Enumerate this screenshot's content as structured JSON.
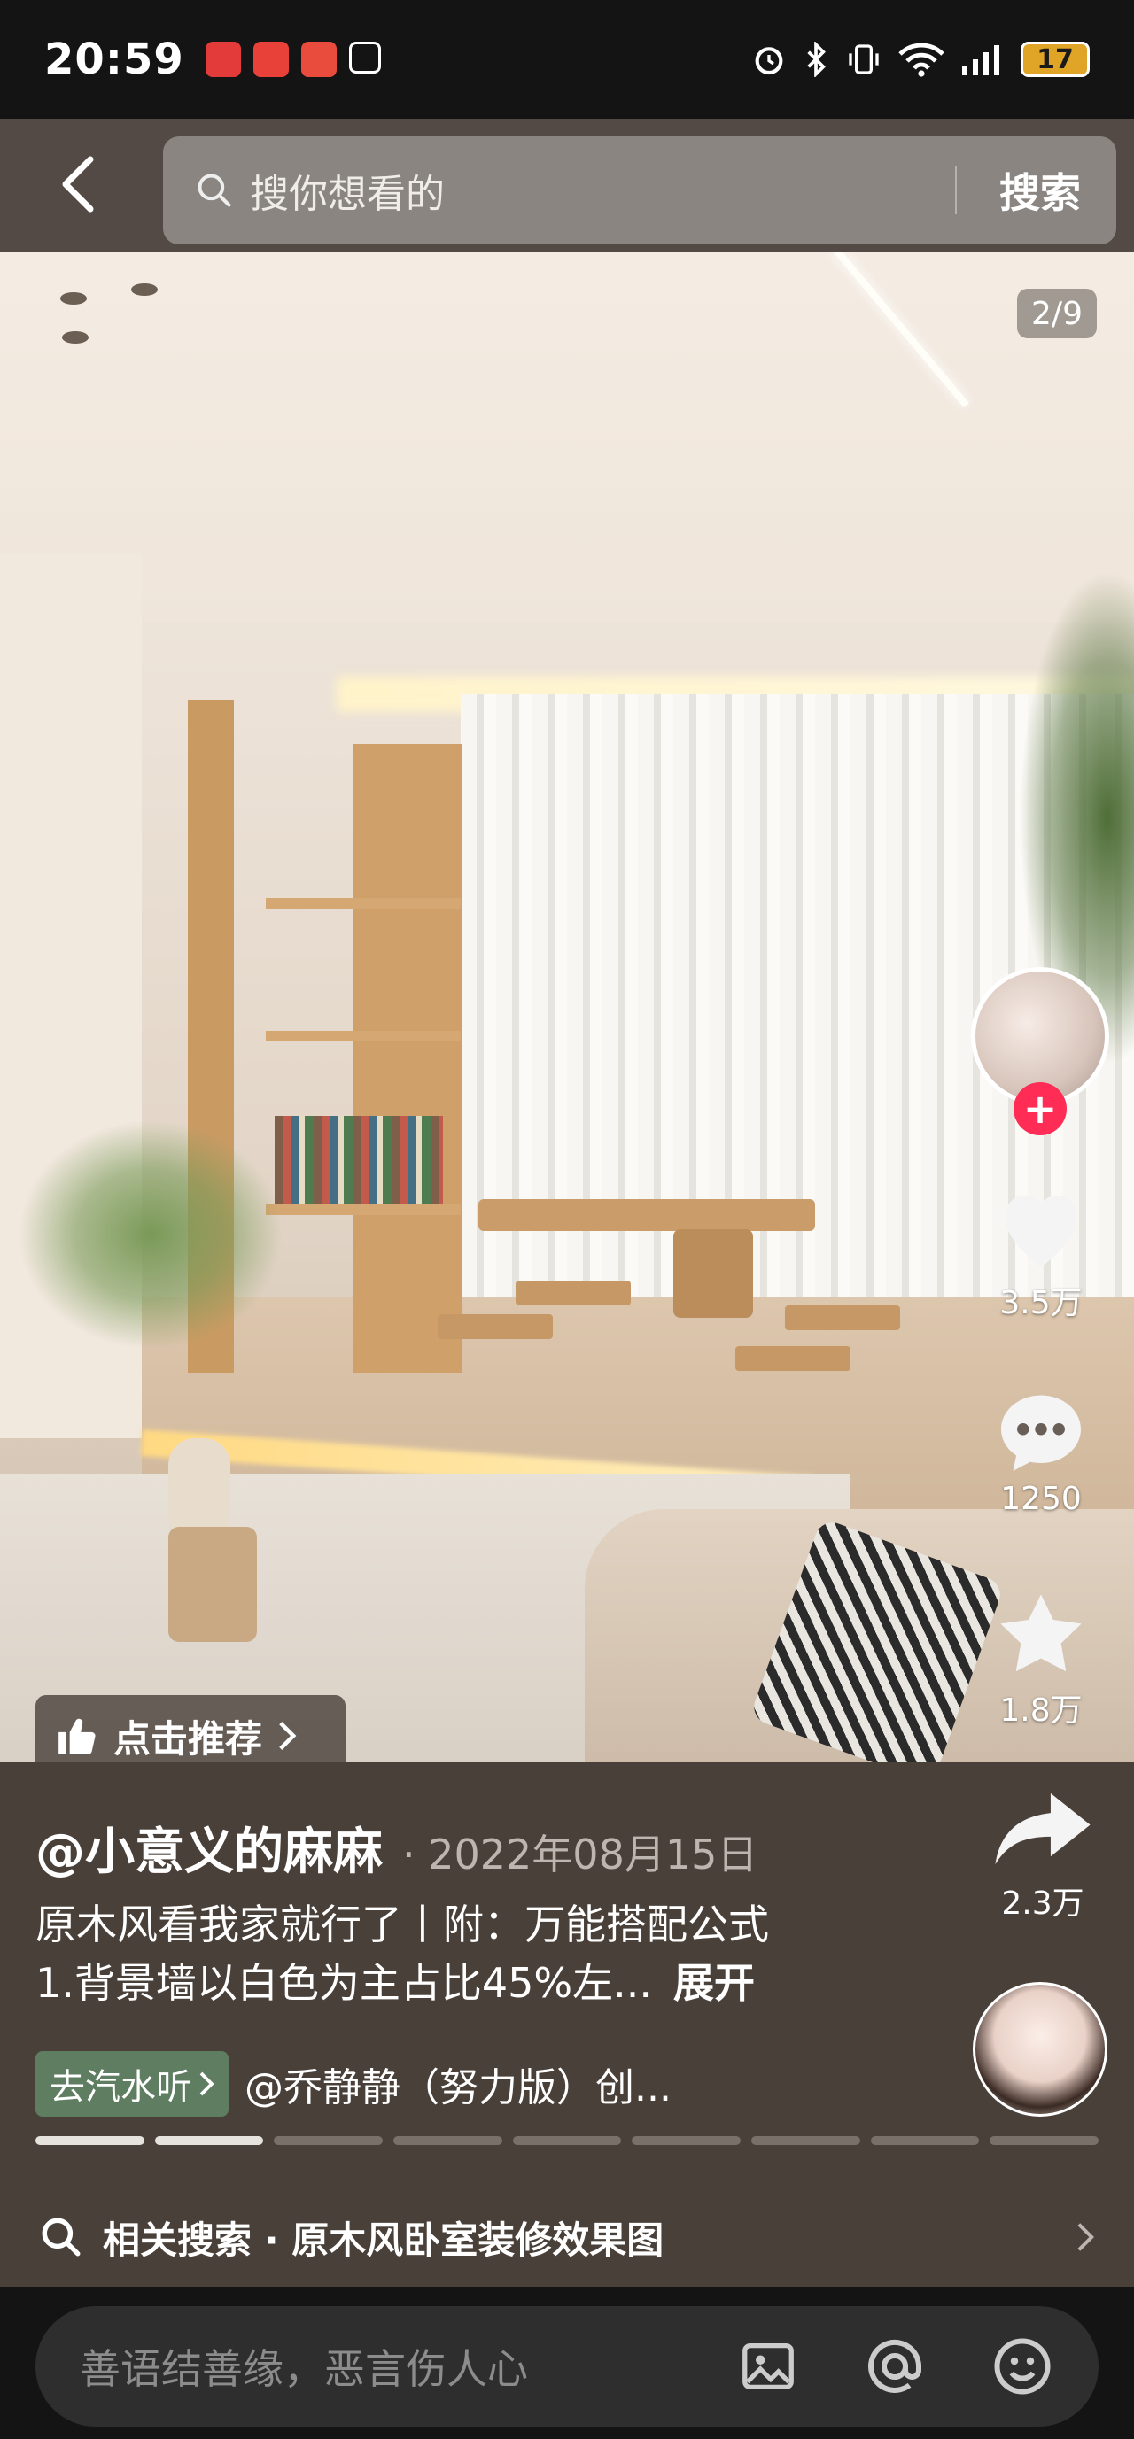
{
  "status_bar": {
    "time": "20:59",
    "battery": "17"
  },
  "top_bar": {
    "search_placeholder": "搜你想看的",
    "search_button": "搜索"
  },
  "media": {
    "page_indicator": "2/9"
  },
  "actions": {
    "likes": "3.5万",
    "comments": "1250",
    "favorites": "1.8万",
    "shares": "2.3万"
  },
  "recommend": {
    "label": "点击推荐"
  },
  "post": {
    "author": "@小意义的麻麻",
    "date": "· 2022年08月15日",
    "desc_line1": "原木风看我家就行了丨附：万能搭配公式",
    "desc_line2": "1.背景墙以白色为主占比45%左...",
    "expand": "展开",
    "tag_chip": "去汽水听",
    "tag_text": "@乔静静（努力版）创..."
  },
  "progress": {
    "total": 9,
    "current": 2
  },
  "related": {
    "label": "相关搜索 · 原木风卧室装修效果图"
  },
  "comment": {
    "placeholder": "善语结善缘，恶言伤人心"
  },
  "colors": {
    "follow": "#ff2c55",
    "chip": "#5f7d60",
    "panel": "#4a403a"
  }
}
